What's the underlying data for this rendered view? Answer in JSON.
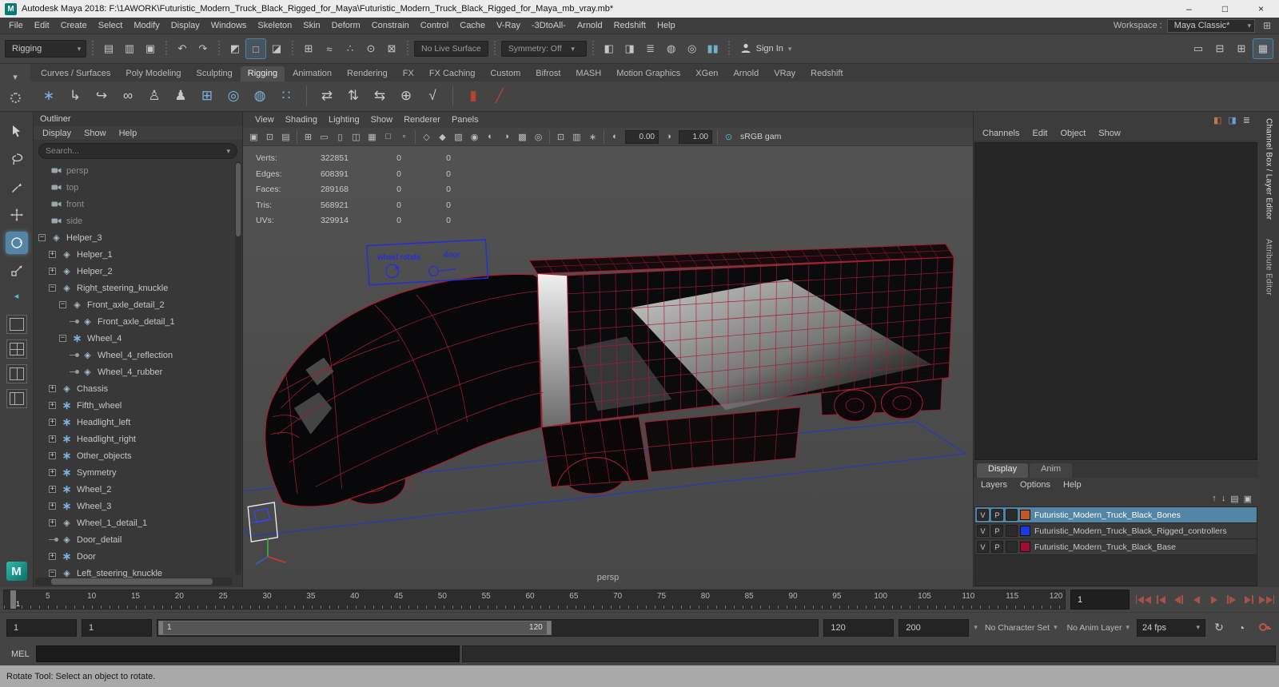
{
  "titlebar": {
    "app_initial": "M",
    "title": "Autodesk Maya 2018: F:\\1AWORK\\Futuristic_Modern_Truck_Black_Rigged_for_Maya\\Futuristic_Modern_Truck_Black_Rigged_for_Maya_mb_vray.mb*",
    "minimize": "–",
    "maximize": "□",
    "close": "×"
  },
  "menubar": {
    "items": [
      "File",
      "Edit",
      "Create",
      "Select",
      "Modify",
      "Display",
      "Windows",
      "Skeleton",
      "Skin",
      "Deform",
      "Constrain",
      "Control",
      "Cache",
      "V-Ray",
      "-3DtoAll-",
      "Arnold",
      "Redshift",
      "Help"
    ],
    "workspace_label": "Workspace :",
    "workspace_value": "Maya Classic*"
  },
  "statusline": {
    "mode": "Rigging",
    "live_surface": "No Live Surface",
    "symmetry": "Symmetry: Off",
    "sign_in": "Sign In",
    "groups": {
      "file": [
        {
          "n": "new-scene-icon",
          "g": "▤"
        },
        {
          "n": "open-scene-icon",
          "g": "▥"
        },
        {
          "n": "save-scene-icon",
          "g": "▣"
        }
      ],
      "history": [
        {
          "n": "undo-icon",
          "g": "↶"
        },
        {
          "n": "redo-icon",
          "g": "↷"
        }
      ],
      "selection": [
        {
          "n": "select-hierarchy-icon",
          "g": "◩"
        },
        {
          "n": "select-object-icon",
          "g": "□",
          "active": true
        },
        {
          "n": "select-component-icon",
          "g": "◪"
        }
      ],
      "snap": [
        {
          "n": "snap-grid-icon",
          "g": "⊞"
        },
        {
          "n": "snap-curve-icon",
          "g": "≈"
        },
        {
          "n": "snap-point-icon",
          "g": "∴"
        },
        {
          "n": "snap-center-icon",
          "g": "⊙"
        },
        {
          "n": "snap-view-plane-icon",
          "g": "⊠"
        }
      ],
      "render": [
        {
          "n": "render-frame-icon",
          "g": "◧"
        },
        {
          "n": "ipr-render-icon",
          "g": "◨"
        },
        {
          "n": "render-settings-icon",
          "g": "≣"
        },
        {
          "n": "hypershade-icon",
          "g": "◍"
        },
        {
          "n": "light-editor-icon",
          "g": "◎"
        },
        {
          "n": "pause-viewport-icon",
          "g": "▮▮",
          "c": "#6fb3c8"
        }
      ],
      "right": [
        {
          "n": "single-pane-layout-icon",
          "g": "▭"
        },
        {
          "n": "toggle-panels-icon",
          "g": "⊟"
        },
        {
          "n": "workspace-grid-icon",
          "g": "⊞"
        },
        {
          "n": "modeling-toolkit-icon",
          "g": "▦",
          "active": true
        }
      ]
    }
  },
  "shelf": {
    "tabs": [
      "Curves / Surfaces",
      "Poly Modeling",
      "Sculpting",
      "Rigging",
      "Animation",
      "Rendering",
      "FX",
      "FX Caching",
      "Custom",
      "Bifrost",
      "MASH",
      "Motion Graphics",
      "XGen",
      "Arnold",
      "VRay",
      "Redshift"
    ],
    "active": "Rigging",
    "icons": [
      {
        "n": "joint-tool-icon",
        "g": "∗",
        "c": "#7fb0dd"
      },
      {
        "n": "ik-handle-tool-icon",
        "g": "↳",
        "c": "#c9c9c9"
      },
      {
        "n": "ik-spline-tool-icon",
        "g": "↪",
        "c": "#c9c9c9"
      },
      {
        "n": "connect-joint-icon",
        "g": "∞",
        "c": "#c9c9c9"
      },
      {
        "n": "bind-skin-icon",
        "g": "♙",
        "c": "#c9c9c9"
      },
      {
        "n": "interactive-bind-icon",
        "g": "♟",
        "c": "#c9c9c9"
      },
      {
        "n": "lattice-icon",
        "g": "⊞",
        "c": "#7fb0dd"
      },
      {
        "n": "wrap-deformer-icon",
        "g": "◎",
        "c": "#7fb0dd"
      },
      {
        "n": "soft-mod-icon",
        "g": "◍",
        "c": "#7fb0dd"
      },
      {
        "n": "cluster-icon",
        "g": "∷",
        "c": "#7fb0dd"
      },
      {
        "sep": true
      },
      {
        "n": "set-driven-key-icon",
        "g": "⇄",
        "c": "#c9c9c9"
      },
      {
        "n": "pose-editor-icon",
        "g": "⇅",
        "c": "#c9c9c9"
      },
      {
        "n": "shape-editor-icon",
        "g": "⇆",
        "c": "#c9c9c9"
      },
      {
        "n": "constraint-icon",
        "g": "⊕",
        "c": "#c9c9c9"
      },
      {
        "n": "hik-icon",
        "g": "√",
        "c": "#c9c9c9"
      },
      {
        "sep": true
      },
      {
        "n": "muscle-builder-icon",
        "g": "▮",
        "c": "#b8412f"
      },
      {
        "n": "muscle-spline-icon",
        "g": "╱",
        "c": "#b8412f"
      }
    ]
  },
  "toolbox": {
    "tools": [
      {
        "n": "select-tool"
      },
      {
        "n": "lasso-tool"
      },
      {
        "n": "paint-select-tool"
      },
      {
        "n": "move-tool"
      },
      {
        "n": "rotate-tool",
        "active": true
      },
      {
        "n": "scale-tool"
      }
    ],
    "layouts": [
      {
        "n": "layout-single-pane",
        "t": "single"
      },
      {
        "n": "layout-four-panes",
        "t": "quad"
      },
      {
        "n": "layout-two-panes",
        "t": "split"
      },
      {
        "n": "layout-outliner-persp",
        "t": "split2"
      }
    ]
  },
  "outliner": {
    "title": "Outliner",
    "menus": [
      "Display",
      "Show",
      "Help"
    ],
    "search_placeholder": "Search...",
    "items": [
      {
        "label": "persp",
        "level": 1,
        "exp": "none",
        "icon": "camera",
        "dim": true
      },
      {
        "label": "top",
        "level": 1,
        "exp": "none",
        "icon": "camera",
        "dim": true
      },
      {
        "label": "front",
        "level": 1,
        "exp": "none",
        "icon": "camera",
        "dim": true
      },
      {
        "label": "side",
        "level": 1,
        "exp": "none",
        "icon": "camera",
        "dim": true
      },
      {
        "label": "Helper_3",
        "level": 1,
        "exp": "minus",
        "icon": "transform"
      },
      {
        "label": "Helper_1",
        "level": 2,
        "exp": "plus",
        "icon": "transform"
      },
      {
        "label": "Helper_2",
        "level": 2,
        "exp": "plus",
        "icon": "transform"
      },
      {
        "label": "Right_steering_knuckle",
        "level": 2,
        "exp": "minus",
        "icon": "transform"
      },
      {
        "label": "Front_axle_detail_2",
        "level": 3,
        "exp": "minus",
        "icon": "transform"
      },
      {
        "label": "Front_axle_detail_1",
        "level": 4,
        "exp": "dot",
        "icon": "transform"
      },
      {
        "label": "Wheel_4",
        "level": 3,
        "exp": "minus",
        "icon": "joint"
      },
      {
        "label": "Wheel_4_reflection",
        "level": 4,
        "exp": "dot",
        "icon": "transform"
      },
      {
        "label": "Wheel_4_rubber",
        "level": 4,
        "exp": "dot",
        "icon": "transform"
      },
      {
        "label": "Chassis",
        "level": 2,
        "exp": "plus",
        "icon": "transform"
      },
      {
        "label": "Fifth_wheel",
        "level": 2,
        "exp": "plus",
        "icon": "joint"
      },
      {
        "label": "Headlight_left",
        "level": 2,
        "exp": "plus",
        "icon": "joint"
      },
      {
        "label": "Headlight_right",
        "level": 2,
        "exp": "plus",
        "icon": "joint"
      },
      {
        "label": "Other_objects",
        "level": 2,
        "exp": "plus",
        "icon": "joint"
      },
      {
        "label": "Symmetry",
        "level": 2,
        "exp": "plus",
        "icon": "joint"
      },
      {
        "label": "Wheel_2",
        "level": 2,
        "exp": "plus",
        "icon": "joint"
      },
      {
        "label": "Wheel_3",
        "level": 2,
        "exp": "plus",
        "icon": "joint"
      },
      {
        "label": "Wheel_1_detail_1",
        "level": 2,
        "exp": "plus",
        "icon": "transform"
      },
      {
        "label": "Door_detail",
        "level": 2,
        "exp": "dot",
        "icon": "transform"
      },
      {
        "label": "Door",
        "level": 2,
        "exp": "plus",
        "icon": "joint"
      },
      {
        "label": "Left_steering_knuckle",
        "level": 2,
        "exp": "minus",
        "icon": "transform"
      }
    ]
  },
  "viewport": {
    "menus": [
      "View",
      "Shading",
      "Lighting",
      "Show",
      "Renderer",
      "Panels"
    ],
    "toolbar": [
      {
        "n": "camera-select-icon",
        "g": "▣"
      },
      {
        "n": "camera-lock-icon",
        "g": "⊡"
      },
      {
        "n": "camera-attributes-icon",
        "g": "▤"
      },
      {
        "sep": true
      },
      {
        "n": "grid-toggle-icon",
        "g": "⊞"
      },
      {
        "n": "film-gate-icon",
        "g": "▭"
      },
      {
        "n": "resolution-gate-icon",
        "g": "▯"
      },
      {
        "n": "gate-mask-icon",
        "g": "◫"
      },
      {
        "n": "field-chart-icon",
        "g": "▦"
      },
      {
        "n": "safe-action-icon",
        "g": "□"
      },
      {
        "n": "safe-title-icon",
        "g": "▫"
      },
      {
        "sep": true
      },
      {
        "n": "wireframe-icon",
        "g": "◇"
      },
      {
        "n": "smooth-shade-icon",
        "g": "◆"
      },
      {
        "n": "textured-icon",
        "g": "▨"
      },
      {
        "n": "use-lights-icon",
        "g": "◉"
      },
      {
        "n": "shadows-icon",
        "g": "◐"
      },
      {
        "n": "ao-icon",
        "g": "◑"
      },
      {
        "n": "anti-alias-icon",
        "g": "▩"
      },
      {
        "n": "dof-icon",
        "g": "◎"
      },
      {
        "sep": true
      },
      {
        "n": "isolate-select-icon",
        "g": "⊡"
      },
      {
        "n": "xray-icon",
        "g": "▥"
      },
      {
        "n": "joint-xray-icon",
        "g": "∗"
      }
    ],
    "exposure": "0.00",
    "gamma": "1.00",
    "color_mgmt": "sRGB gam",
    "camera_label": "persp",
    "controls": {
      "wheel_rotate": "wheel rotate",
      "door": "door"
    },
    "hud_rows": [
      {
        "label": "Verts:",
        "a": "322851",
        "b": "0",
        "c": "0"
      },
      {
        "label": "Edges:",
        "a": "608391",
        "b": "0",
        "c": "0"
      },
      {
        "label": "Faces:",
        "a": "289168",
        "b": "0",
        "c": "0"
      },
      {
        "label": "Tris:",
        "a": "568921",
        "b": "0",
        "c": "0"
      },
      {
        "label": "UVs:",
        "a": "329914",
        "b": "0",
        "c": "0"
      }
    ]
  },
  "channelbox": {
    "top_icons": [
      {
        "n": "channel-manip-icon",
        "g": "◧",
        "c": "#c0784a"
      },
      {
        "n": "channel-speed-icon",
        "g": "◨",
        "c": "#6f9ed0"
      },
      {
        "n": "channel-hyperbolic-icon",
        "g": "≣",
        "c": "#b5b5b5"
      }
    ],
    "menus": [
      "Channels",
      "Edit",
      "Object",
      "Show"
    ],
    "layer_editor": {
      "tabs": [
        "Display",
        "Anim"
      ],
      "active_tab": "Display",
      "menus": [
        "Layers",
        "Options",
        "Help"
      ],
      "toolbar_icons": [
        {
          "n": "layer-move-up-icon",
          "g": "↑"
        },
        {
          "n": "layer-move-down-icon",
          "g": "↓"
        },
        {
          "n": "new-empty-layer-icon",
          "g": "▤"
        },
        {
          "n": "new-layer-from-selected-icon",
          "g": "▣"
        }
      ],
      "layers": [
        {
          "v": "V",
          "p": "P",
          "swatch": "#c0562a",
          "name": "Futuristic_Modern_Truck_Black_Bones",
          "selected": true
        },
        {
          "v": "V",
          "p": "P",
          "swatch": "#2038e0",
          "name": "Futuristic_Modern_Truck_Black_Rigged_controllers",
          "selected": false
        },
        {
          "v": "V",
          "p": "P",
          "swatch": "#a10d2f",
          "name": "Futuristic_Modern_Truck_Black_Base",
          "selected": false
        }
      ]
    }
  },
  "right_tabs": [
    {
      "label": "Channel Box / Layer Editor",
      "active": true
    },
    {
      "label": "Attribute Editor",
      "active": false
    }
  ],
  "timeline": {
    "marker_label": "1",
    "ticks": [
      5,
      10,
      15,
      20,
      25,
      30,
      35,
      40,
      45,
      50,
      55,
      60,
      65,
      70,
      75,
      80,
      85,
      90,
      95,
      100,
      105,
      110,
      115,
      120
    ],
    "range_max": 121,
    "frame_field": "1",
    "playback": [
      {
        "n": "go-to-start-button",
        "k": "b<<"
      },
      {
        "n": "step-back-frame-button",
        "k": "b<"
      },
      {
        "n": "step-back-key-button",
        "k": "<b"
      },
      {
        "n": "play-backwards-button",
        "k": "<"
      },
      {
        "n": "play-forward-button",
        "k": ">"
      },
      {
        "n": "step-forward-key-button",
        "k": "b>"
      },
      {
        "n": "step-forward-frame-button",
        "k": ">b"
      },
      {
        "n": "go-to-end-button",
        "k": ">>b"
      }
    ]
  },
  "rangeslider": {
    "anim_start": "1",
    "playback_start": "1",
    "bar_start_label": "1",
    "bar_end_label": "120",
    "playback_end": "120",
    "anim_end": "200",
    "character_set": "No Character Set",
    "anim_layer": "No Anim Layer",
    "fps": "24 fps"
  },
  "commandline": {
    "label": "MEL"
  },
  "helpline": {
    "text": "Rotate Tool: Select an object to rotate."
  }
}
